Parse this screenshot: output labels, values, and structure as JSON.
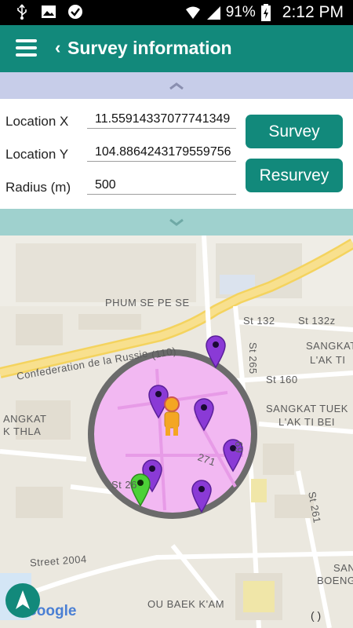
{
  "status_bar": {
    "battery": "91%",
    "time": "2:12 PM",
    "icons": [
      "usb-icon",
      "image-icon",
      "check-icon",
      "wifi-icon",
      "signal-icon",
      "battery-icon"
    ]
  },
  "app_bar": {
    "title": "Survey information",
    "menu_icon": "menu-icon",
    "back_icon": "chevron-left-icon",
    "color": "#12897b"
  },
  "form": {
    "location_x": {
      "label": "Location X",
      "value": "11.55914337077741349"
    },
    "location_y": {
      "label": "Location Y",
      "value": "104.8864243179559756"
    },
    "radius": {
      "label": "Radius (m)",
      "value": "500"
    },
    "survey_button": "Survey",
    "resurvey_button": "Resurvey"
  },
  "map": {
    "labels": {
      "phum_se_pe_se": "PHUM SE PE SE",
      "confederation": "Confederation de la Russie",
      "route_110": "(110)",
      "st_132": "St 132",
      "st_132z": "St 132z",
      "st_265": "St 265",
      "st_160": "St 160",
      "sangkat_lak_1": "SANGKAT",
      "sangkat_lak_2": "L'AK TI",
      "sangkat_tuek_1": "SANGKAT TUEK",
      "sangkat_tuek_2": "L'AK TI BEI",
      "sangkat_left_1": "ANGKAT",
      "sangkat_left_2": "K THLA",
      "st_271": "271",
      "st_269": "69",
      "st_26": "St 26",
      "st_261": "St 261",
      "street_2004": "Street 2004",
      "san_1": "SAN",
      "boeng": "BOENG",
      "ou_baek_kam": "OU BAEK K'AM",
      "google": "Google",
      "paren": "( )"
    },
    "markers": {
      "purple_count": 6,
      "green_count": 1,
      "purple_color": "#8a3ad6",
      "green_color": "#4cd137",
      "circle_fill": "#f2b8f2",
      "circle_stroke": "#6b6b6b"
    }
  }
}
